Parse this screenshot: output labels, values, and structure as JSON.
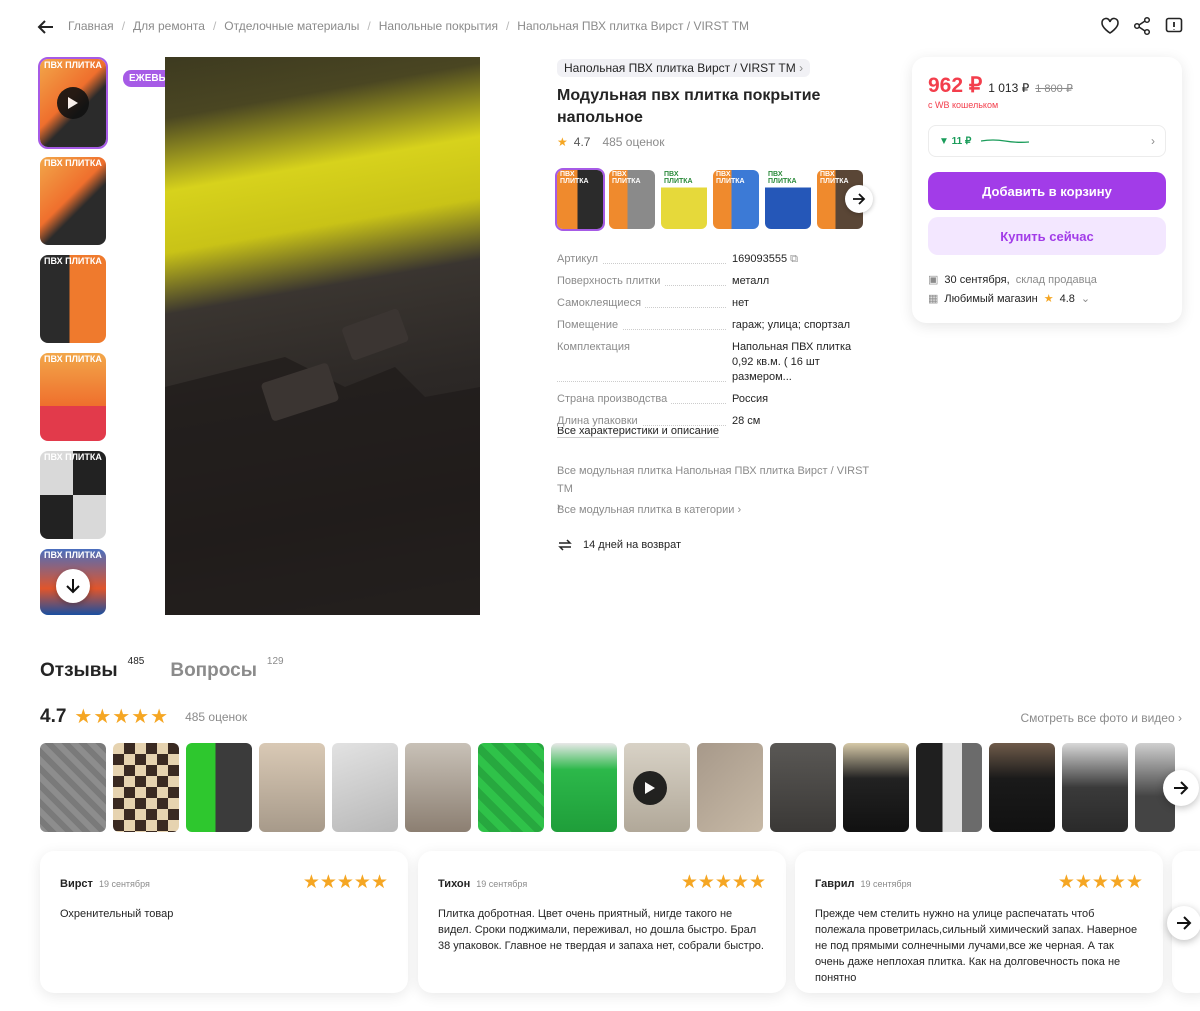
{
  "breadcrumbs": [
    "Главная",
    "Для ремонта",
    "Отделочные материалы",
    "Напольные покрытия",
    "Напольная ПВХ плитка Вирст / VIRST TM"
  ],
  "gallery": {
    "badge": "ЕЖЕВЫГОДА",
    "thumb_label": "ПВХ ПЛИТКА"
  },
  "product": {
    "brand": "Напольная ПВХ плитка Вирст / VIRST TM",
    "title": "Модульная пвх плитка покрытие напольное",
    "rating": "4.7",
    "rating_count": "485 оценок",
    "specs": [
      {
        "k": "Артикул",
        "v": "169093555"
      },
      {
        "k": "Поверхность плитки",
        "v": "металл"
      },
      {
        "k": "Самоклеящиеся",
        "v": "нет"
      },
      {
        "k": "Помещение",
        "v": "гараж; улица; спортзал"
      },
      {
        "k": "Комплектация",
        "v": "Напольная ПВХ плитка 0,92 кв.м. ( 16 шт размером..."
      },
      {
        "k": "Страна производства",
        "v": "Россия"
      },
      {
        "k": "Длина упаковки",
        "v": "28 см"
      }
    ],
    "all_specs": "Все характеристики и описание",
    "brand_link": "Все модульная плитка Напольная ПВХ плитка Вирст / VIRST TM",
    "category_link": "Все модульная плитка в категории",
    "returns": "14 дней на возврат"
  },
  "buybox": {
    "price": "962 ₽",
    "price_wo_wallet": "1 013 ₽",
    "old_price": "1 800 ₽",
    "wallet_note": "с WB кошельком",
    "price_drop": "▼ 11 ₽",
    "add_to_cart": "Добавить в корзину",
    "buy_now": "Купить сейчас",
    "delivery_date": "30 сентября,",
    "delivery_from": "склад продавца",
    "shop_label": "Любимый магазин",
    "shop_rating": "4.8"
  },
  "reviews": {
    "tab_reviews": "Отзывы",
    "tab_reviews_count": "485",
    "tab_questions": "Вопросы",
    "tab_questions_count": "129",
    "rating": "4.7",
    "count": "485 оценок",
    "see_all": "Смотреть все фото и видео",
    "items": [
      {
        "name": "Вирст",
        "date": "19 сентября",
        "text": "Охренительный товар"
      },
      {
        "name": "Тихон",
        "date": "19 сентября",
        "text": "Плитка добротная. Цвет очень приятный, нигде такого не видел. Сроки поджимали, переживал, но дошла быстро. Брал 38 упаковок. Главное не твердая и запаха нет, собрали быстро."
      },
      {
        "name": "Гаврил",
        "date": "19 сентября",
        "text": "Прежде чем стелить нужно на улице распечатать чтоб полежала проветрилась,сильный химический запах. Наверное не под прямыми солнечными лучами,все же черная. А так очень даже неплохая плитка. Как на долговечность пока не понятно"
      }
    ]
  },
  "colors": {
    "accent": "#a23ce8",
    "price": "#f33e4c",
    "star": "#f5a623"
  }
}
